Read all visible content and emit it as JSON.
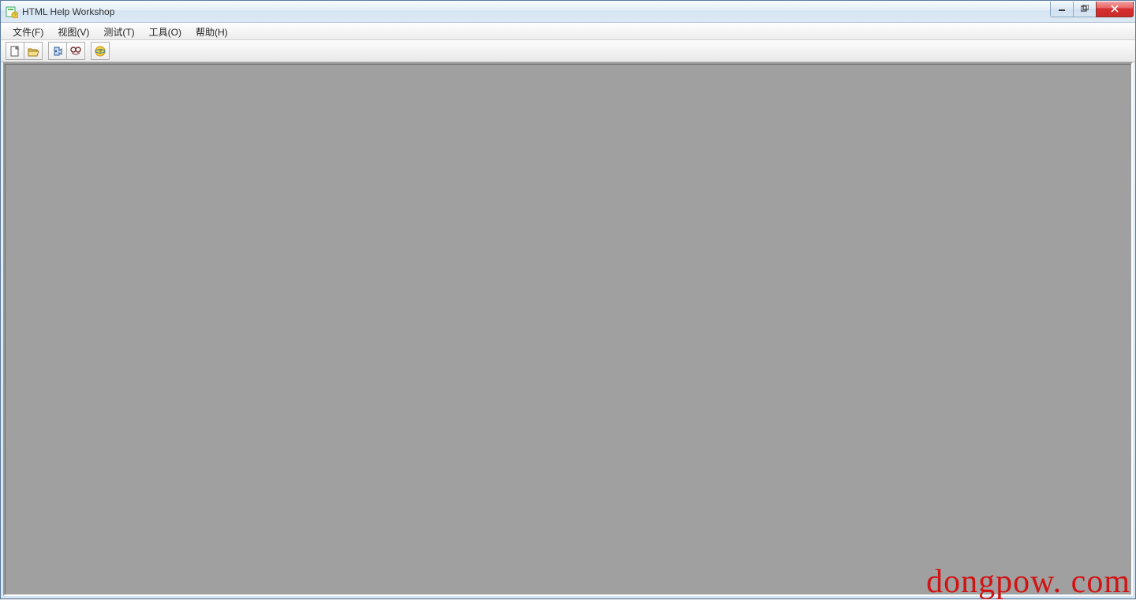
{
  "window": {
    "title": "HTML Help Workshop"
  },
  "menu": {
    "items": [
      "文件(F)",
      "视图(V)",
      "测试(T)",
      "工具(O)",
      "帮助(H)"
    ]
  },
  "toolbar": {
    "buttons": [
      {
        "name": "new",
        "icon": "new-file-icon"
      },
      {
        "name": "open",
        "icon": "open-folder-icon"
      },
      {
        "name": "compile",
        "icon": "compile-icon"
      },
      {
        "name": "view",
        "icon": "view-compiled-icon"
      },
      {
        "name": "help",
        "icon": "help-icon"
      }
    ]
  },
  "watermark": "dongpow. com"
}
